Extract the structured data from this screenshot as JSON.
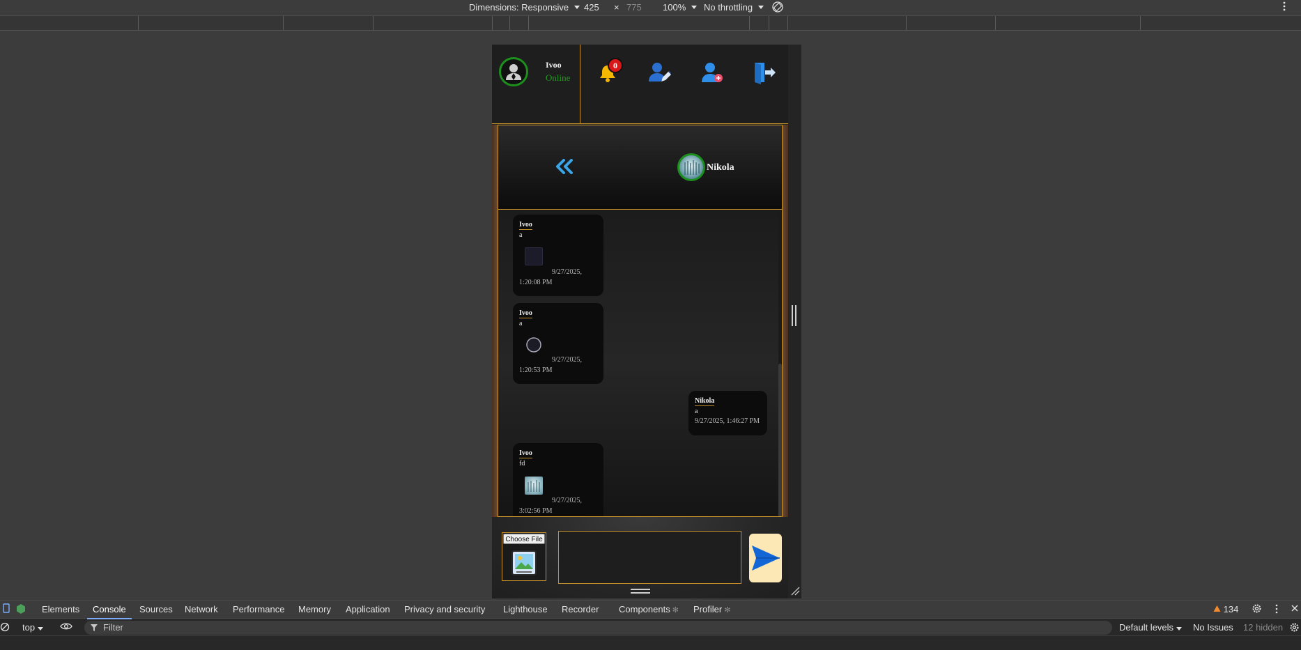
{
  "devtools_toolbar": {
    "dimensions_label": "Dimensions: Responsive",
    "width": "425",
    "times": "×",
    "height": "775",
    "zoom": "100%",
    "throttling": "No throttling"
  },
  "app": {
    "current_user": {
      "name": "Ivoo",
      "status": "Online"
    },
    "notifications_count": "0",
    "peer": {
      "name": "Nikola"
    },
    "messages": [
      {
        "from": "Ivoo",
        "text": "a",
        "time_line1": "9/27/2025,",
        "time_line2": "1:20:08 PM",
        "attachment": "dark-image"
      },
      {
        "from": "Ivoo",
        "text": "a",
        "time_line1": "9/27/2025,",
        "time_line2": "1:20:53 PM",
        "attachment": "circle-image"
      },
      {
        "from": "Nikola",
        "text": "a",
        "time_line1": "9/27/2025, 1:46:27 PM",
        "time_line2": "",
        "attachment": ""
      },
      {
        "from": "Ivoo",
        "text": "fd",
        "time_line1": "9/27/2025,",
        "time_line2": "3:02:56 PM",
        "attachment": "photo-image"
      }
    ],
    "composer": {
      "choose_file": "Choose File",
      "message_value": ""
    }
  },
  "devtools": {
    "tabs": [
      "Elements",
      "Console",
      "Sources",
      "Network",
      "Performance",
      "Memory",
      "Application",
      "Privacy and security",
      "Lighthouse",
      "Recorder",
      "Components",
      "Profiler"
    ],
    "active_tab": "Console",
    "warnings_count": "134",
    "context": "top",
    "filter_placeholder": "Filter",
    "levels": "Default levels",
    "issues": "No Issues",
    "hidden": "12 hidden"
  },
  "colors": {
    "accent_border": "#c8922a",
    "online_green": "#1f9a1f",
    "badge_red": "#d9181a",
    "send_bg": "#fce8b4",
    "tab_underline": "#7cacf8"
  }
}
